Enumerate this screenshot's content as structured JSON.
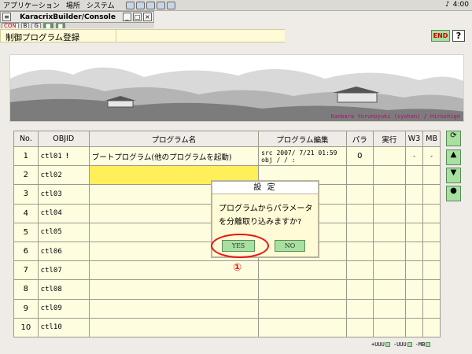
{
  "os_bar": {
    "menu": [
      "アプリケーション",
      "場所",
      "システム"
    ],
    "clock": "4:00"
  },
  "window": {
    "title": "KaracrixBuilder/Console",
    "controls": [
      "_",
      "□",
      "×"
    ],
    "toolbar": [
      "CON",
      "B",
      "G",
      "■",
      "■"
    ]
  },
  "header": {
    "page_title": "制御プログラム登録",
    "end_label": "END",
    "help_label": "?"
  },
  "banner": {
    "credit": "Kanbara Yorunoyuki (syohan) / Hiroshige"
  },
  "table": {
    "columns": [
      "No.",
      "OBJID",
      "プログラム名",
      "プログラム編集",
      "パラ",
      "実行",
      "W3",
      "MB"
    ],
    "rows": [
      {
        "no": "1",
        "objid": "ctl01",
        "flag": "!",
        "name": "ブートプログラム(他のプログラムを起動)",
        "edit_src": "src   2007/ 7/21 01:59",
        "edit_obj": "obj      /  /      :",
        "para": "0",
        "exec": "",
        "w3": "-",
        "mb": "-"
      },
      {
        "no": "2",
        "objid": "ctl02",
        "flag": "",
        "name": "",
        "edit_src": "",
        "edit_obj": "",
        "para": "",
        "exec": "",
        "w3": "",
        "mb": ""
      },
      {
        "no": "3",
        "objid": "ctl03",
        "flag": "",
        "name": "",
        "edit_src": "",
        "edit_obj": "",
        "para": "",
        "exec": "",
        "w3": "",
        "mb": ""
      },
      {
        "no": "4",
        "objid": "ctl04",
        "flag": "",
        "name": "",
        "edit_src": "",
        "edit_obj": "",
        "para": "",
        "exec": "",
        "w3": "",
        "mb": ""
      },
      {
        "no": "5",
        "objid": "ctl05",
        "flag": "",
        "name": "",
        "edit_src": "",
        "edit_obj": "",
        "para": "",
        "exec": "",
        "w3": "",
        "mb": ""
      },
      {
        "no": "6",
        "objid": "ctl06",
        "flag": "",
        "name": "",
        "edit_src": "",
        "edit_obj": "",
        "para": "",
        "exec": "",
        "w3": "",
        "mb": ""
      },
      {
        "no": "7",
        "objid": "ctl07",
        "flag": "",
        "name": "",
        "edit_src": "",
        "edit_obj": "",
        "para": "",
        "exec": "",
        "w3": "",
        "mb": ""
      },
      {
        "no": "8",
        "objid": "ctl08",
        "flag": "",
        "name": "",
        "edit_src": "",
        "edit_obj": "",
        "para": "",
        "exec": "",
        "w3": "",
        "mb": ""
      },
      {
        "no": "9",
        "objid": "ctl09",
        "flag": "",
        "name": "",
        "edit_src": "",
        "edit_obj": "",
        "para": "",
        "exec": "",
        "w3": "",
        "mb": ""
      },
      {
        "no": "10",
        "objid": "ctl10",
        "flag": "",
        "name": "",
        "edit_src": "",
        "edit_obj": "",
        "para": "",
        "exec": "",
        "w3": "",
        "mb": ""
      }
    ]
  },
  "side_controls": {
    "refresh_icon": "refresh-icon",
    "up_icon": "arrow-up-icon",
    "down_icon": "arrow-down-icon",
    "dot_icon": "dot-icon"
  },
  "footer": [
    "+UUU",
    "-UUU",
    "-MB"
  ],
  "dialog": {
    "title": "設 定",
    "message_line1": "プログラムからパラメータ",
    "message_line2": "を分離取り込みますか?",
    "yes_label": "YES",
    "no_label": "NO"
  },
  "annotation": {
    "callout": "①",
    "color": "#e11111"
  }
}
